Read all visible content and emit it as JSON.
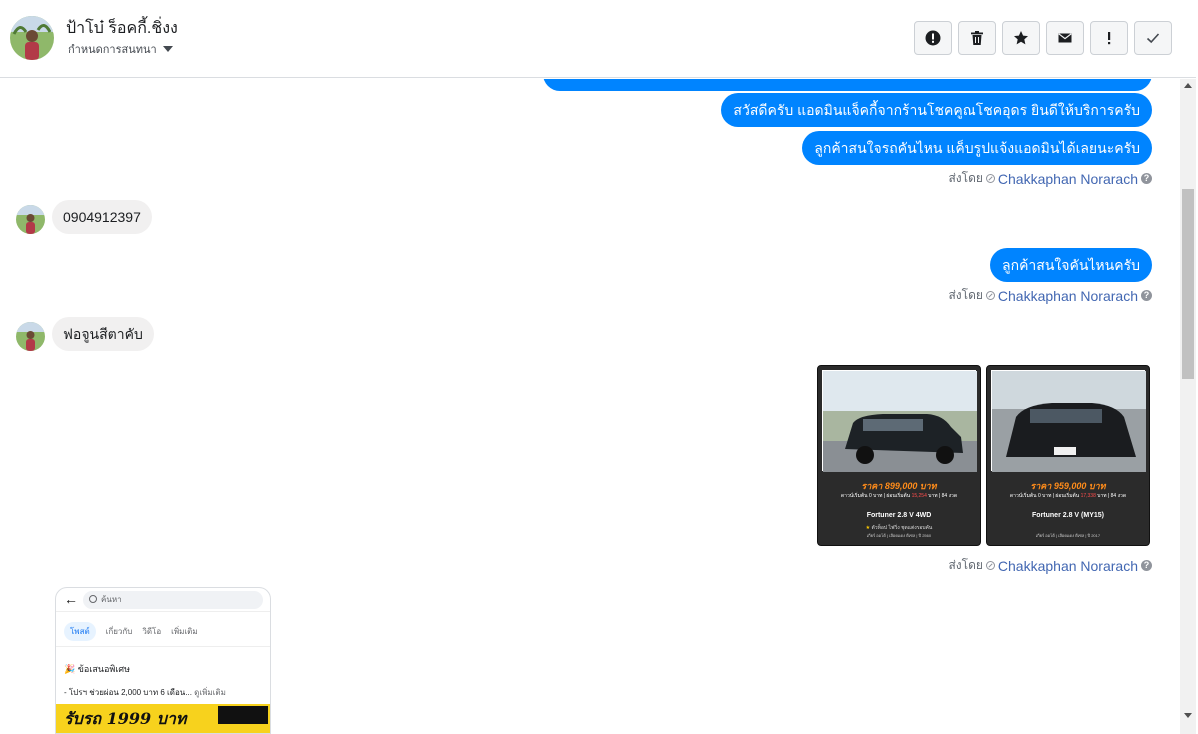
{
  "header": {
    "contact_name": "ป้าโบ๋ ร็อคกี้.ชิ่งง",
    "conversation_settings": "กำหนดการสนทนา",
    "toolbar": [
      {
        "icon": "alert-circle-icon"
      },
      {
        "icon": "trash-icon"
      },
      {
        "icon": "star-icon"
      },
      {
        "icon": "envelope-icon"
      },
      {
        "icon": "exclamation-icon"
      },
      {
        "icon": "checkmark-icon"
      }
    ]
  },
  "messages": {
    "out_greeting": "สวัสดีครับ แอดมินแจ็คกี้จากร้านโชคคูณโชคอุดร ยินดีให้บริการครับ",
    "out_ask_photo": "ลูกค้าสนใจรถคันไหน แค็บรูปแจ้งแอดมินได้เลยนะครับ",
    "in_phone": "0904912397",
    "out_ask_car": "ลูกค้าสนใจคันไหนครับ",
    "in_reply": "ฟอจูนสีตาคับ",
    "sent_by_label": "ส่งโดย",
    "sender_name": "Chakkaphan Norarach"
  },
  "cards": [
    {
      "price": "ราคา 899,000 บาท",
      "terms_pre": "ดาวน์เริ่มต้น 0 บาท | ผ่อนเริ่มต้น ",
      "terms_amount": "15,254",
      "terms_post": " บาท | 84 งวด",
      "model": "Fortuner 2.8 V 4WD",
      "feature": "ตัวท็อป ไฟวิ่ง ชุดแต่งรอบคัน",
      "footer": "เกียร์ ออโต้ | เลือดแดง ดีเซล | ปี 2560"
    },
    {
      "price": "ราคา 959,000 บาท",
      "terms_pre": "ดาวน์เริ่มต้น 0 บาท | ผ่อนเริ่มต้น ",
      "terms_amount": "17,338",
      "terms_post": " บาท | 84 งวด",
      "model": "Fortuner 2.8 V (MY15)",
      "feature": "",
      "footer": "เกียร์ ออโต้ | เลือดแดง ดีเซล | ปี 2017"
    }
  ],
  "attachment": {
    "search_placeholder": "ค้นหา",
    "tabs": [
      "โพสต์",
      "เกี่ยวกับ",
      "วิดีโอ",
      "เพิ่มเติม"
    ],
    "promo_title": "ข้อเสนอพิเศษ",
    "promo_detail": "- โปรฯ ช่วยผ่อน 2,000 บาท 6 เดือน...",
    "see_more": "ดูเพิ่มเติม",
    "banner_text": "รับรถ 1999 บาท"
  },
  "colors": {
    "outgoing_bubble": "#0084ff",
    "incoming_bubble": "#f1f0f0",
    "sender_link": "#4267b2",
    "card_background": "#2b2b2b",
    "card_price": "#ff8c1a"
  }
}
